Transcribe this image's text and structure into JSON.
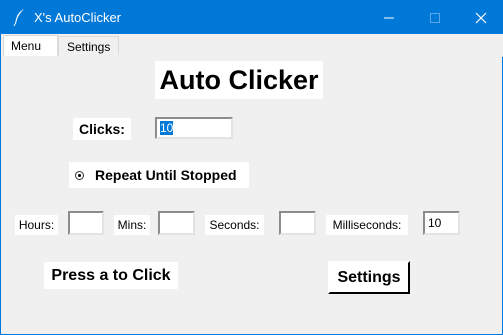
{
  "window": {
    "title": "X's AutoClicker",
    "icons": {
      "app": "feather-icon",
      "minimize": "minimize-icon",
      "maximize": "maximize-icon",
      "close": "close-icon"
    }
  },
  "tabs": [
    {
      "label": "Menu",
      "selected": true
    },
    {
      "label": "Settings",
      "selected": false
    }
  ],
  "main": {
    "title": "Auto Clicker",
    "clicks_label": "Clicks:",
    "clicks_value": "10",
    "repeat_label": "Repeat Until Stopped",
    "repeat_selected": true,
    "time_fields": [
      {
        "label": "Hours:",
        "value": ""
      },
      {
        "label": "Mins:",
        "value": ""
      },
      {
        "label": "Seconds:",
        "value": ""
      },
      {
        "label": "Milliseconds:",
        "value": "10"
      }
    ],
    "press_label": "Press a to Click",
    "settings_button": "Settings"
  },
  "colors": {
    "titlebar": "#0078d7",
    "selection": "#0078d7",
    "window_bg": "#f0f0f0"
  }
}
